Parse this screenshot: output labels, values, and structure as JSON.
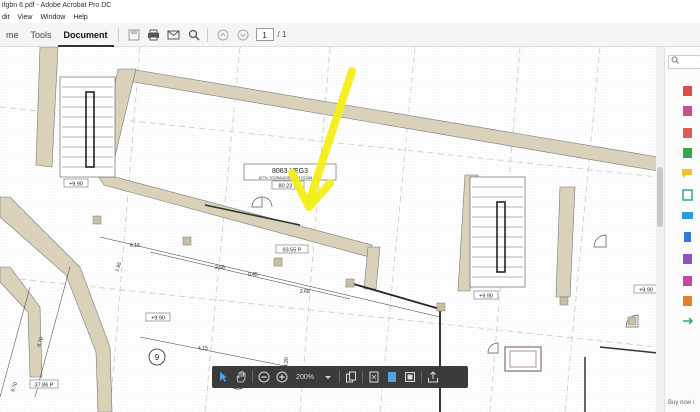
{
  "window": {
    "title": "ifgbn 6.pdf - Adobe Acrobat Pro DC"
  },
  "menu": [
    "dit",
    "View",
    "Window",
    "Help"
  ],
  "toolbar": {
    "tabs": [
      {
        "label": "me",
        "active": false
      },
      {
        "label": "Tools",
        "active": false
      },
      {
        "label": "Document",
        "active": true
      }
    ],
    "page_current": "1",
    "page_total": "/ 1"
  },
  "float_toolbar": {
    "zoom": "200%"
  },
  "sidebar": {
    "footnote": "Buy now i"
  },
  "drawing": {
    "room_number": "8063 YEG3",
    "room_subtitle": "ATTN. STORAGE/BOILER ROOM UNIT",
    "area_1": "80.23 P",
    "area_2": "93.55 P",
    "level_1": "+9.90",
    "level_2": "+9.90",
    "level_3": "+9.90",
    "level_4": "+9.90",
    "dim_1": "6.15",
    "dim_2": "2.66",
    "dim_3": "0.45",
    "dim_4": "2.66",
    "dim_5": "1.95",
    "dim_6": "6.70",
    "dim_7": "4.15",
    "dim_8": "6.70",
    "dim_9": "4.20",
    "grid_1": "9",
    "grid_2": "10",
    "area_3": "37.86 P"
  },
  "colors": {
    "annotation": "#f2ee16",
    "wall": "#d9d2b9",
    "toolbar_dark": "#3b3b3b"
  }
}
